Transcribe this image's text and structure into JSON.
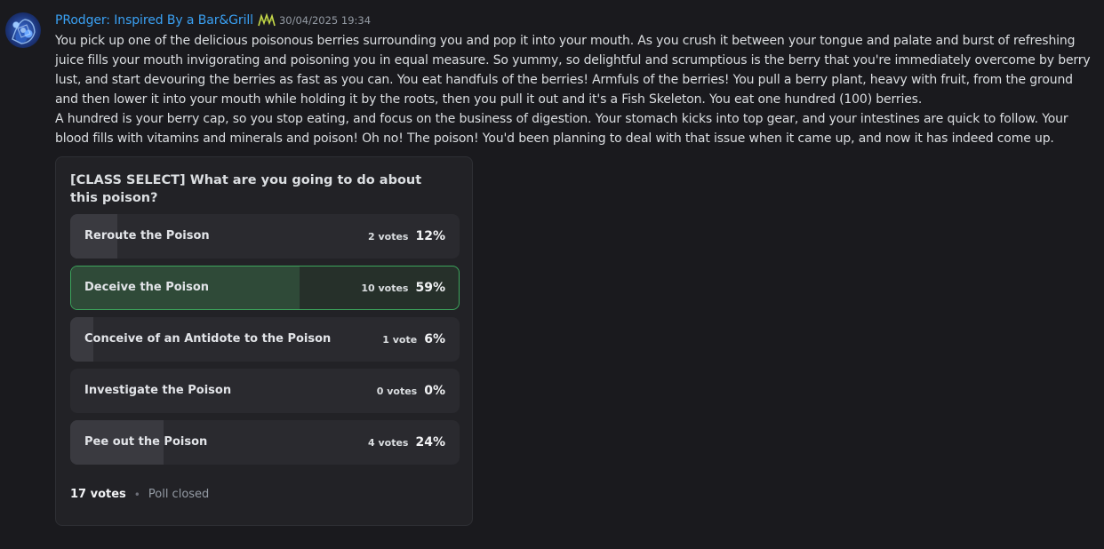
{
  "message": {
    "author": "PRodger: Inspired By a Bar&Grill",
    "timestamp": "30/04/2025 19:34",
    "paragraphs": [
      "You pick up one of the delicious poisonous berries surrounding you and pop it into your mouth. As you crush it between your tongue and palate and burst of refreshing juice fills your mouth invigorating and poisoning you in equal measure. So yummy, so delightful and scrumptious is the berry that you're immediately overcome by berry lust, and start devouring the berries as fast as you can. You eat handfuls of the berries! Armfuls of the berries! You pull a berry plant, heavy with fruit, from the ground and then lower it into your mouth while holding it by the roots, then you pull it out and it's a Fish Skeleton. You eat one hundred (100) berries.",
      "A hundred is your berry cap, so you stop eating, and focus on the business of digestion. Your stomach kicks into top gear, and your intestines are quick to follow. Your blood fills with vitamins and minerals and poison! Oh no! The poison! You'd been planning to deal with that issue when it came up, and now it has indeed come up."
    ]
  },
  "poll": {
    "question": "[CLASS SELECT] What are you going to do about this poison?",
    "options": [
      {
        "label": "Reroute the Poison",
        "votes": "2 votes",
        "percent": "12%",
        "fraction": 0.12,
        "selected": false
      },
      {
        "label": "Deceive the Poison",
        "votes": "10 votes",
        "percent": "59%",
        "fraction": 0.59,
        "selected": true
      },
      {
        "label": "Conceive of an Antidote to the Poison",
        "votes": "1 vote",
        "percent": "6%",
        "fraction": 0.06,
        "selected": false
      },
      {
        "label": "Investigate the Poison",
        "votes": "0 votes",
        "percent": "0%",
        "fraction": 0.0,
        "selected": false
      },
      {
        "label": "Pee out the Poison",
        "votes": "4 votes",
        "percent": "24%",
        "fraction": 0.24,
        "selected": false
      }
    ],
    "total_votes": "17 votes",
    "separator": "•",
    "status": "Poll closed"
  },
  "colors": {
    "author": "#3aa1f4",
    "selected_border": "#3ca55c"
  }
}
